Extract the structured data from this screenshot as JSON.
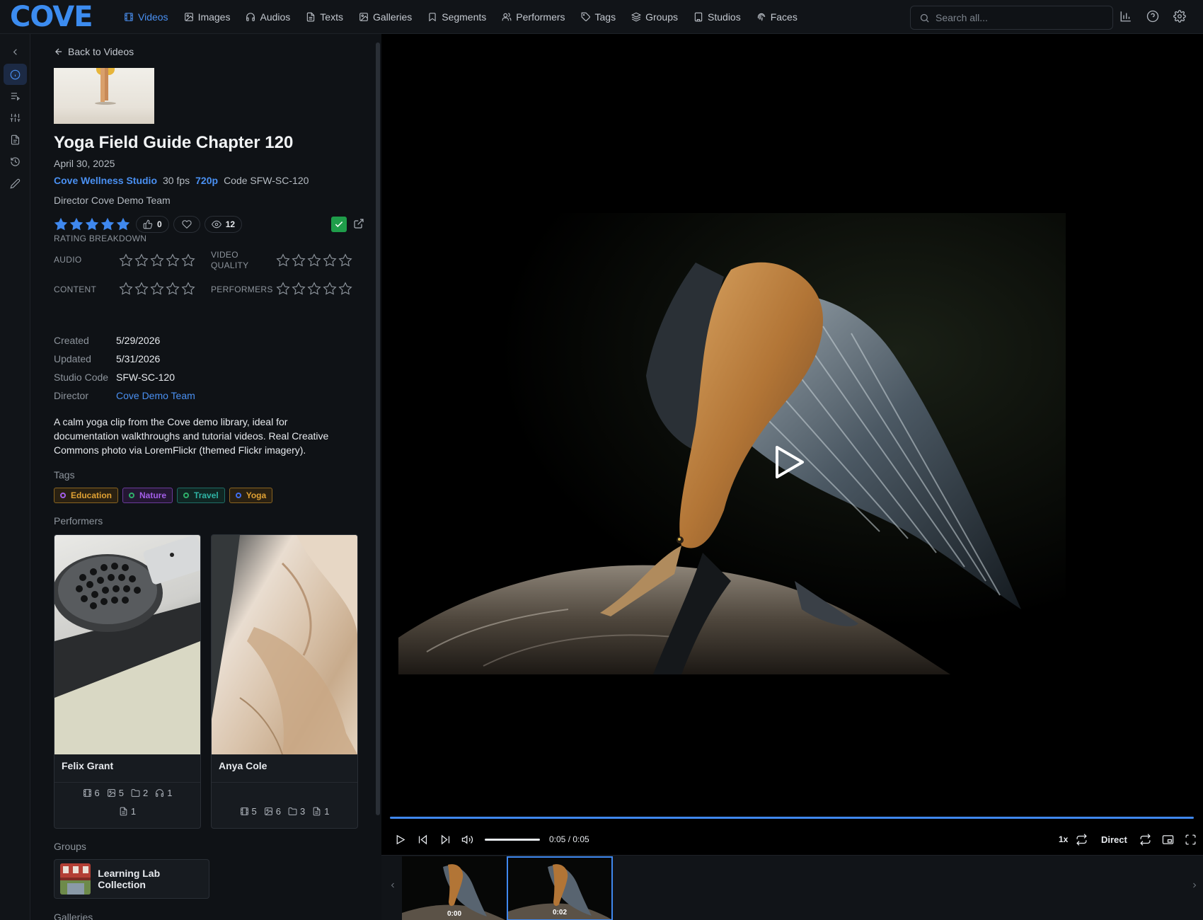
{
  "app": {
    "logo_text": "COVE"
  },
  "nav": {
    "items": [
      {
        "label": "Videos",
        "icon": "film-icon",
        "active": true
      },
      {
        "label": "Images",
        "icon": "image-icon"
      },
      {
        "label": "Audios",
        "icon": "headphones-icon"
      },
      {
        "label": "Texts",
        "icon": "file-text-icon"
      },
      {
        "label": "Galleries",
        "icon": "gallery-icon"
      },
      {
        "label": "Segments",
        "icon": "bookmark-icon"
      },
      {
        "label": "Performers",
        "icon": "users-icon"
      },
      {
        "label": "Tags",
        "icon": "tag-icon"
      },
      {
        "label": "Groups",
        "icon": "layers-icon"
      },
      {
        "label": "Studios",
        "icon": "building-icon"
      },
      {
        "label": "Faces",
        "icon": "fingerprint-icon"
      }
    ],
    "search_placeholder": "Search all...",
    "right_icons": [
      "stats-icon",
      "help-icon",
      "settings-icon"
    ]
  },
  "rail": {
    "items": [
      {
        "icon": "collapse-chevron-icon"
      },
      {
        "icon": "info-icon",
        "active": true
      },
      {
        "icon": "queue-icon"
      },
      {
        "icon": "sliders-icon"
      },
      {
        "icon": "file-icon"
      },
      {
        "icon": "history-icon"
      },
      {
        "icon": "edit-icon"
      }
    ]
  },
  "detail": {
    "back_label": "Back to Videos",
    "title": "Yoga Field Guide Chapter 120",
    "date": "April 30, 2025",
    "studio": "Cove Wellness Studio",
    "fps": "30 fps",
    "resolution": "720p",
    "code_line": "Code SFW-SC-120",
    "director_line": "Director Cove Demo Team",
    "rating": 5,
    "likes": "0",
    "views": "12",
    "rating_breakdown_label": "RATING BREAKDOWN",
    "breakdown": [
      {
        "label": "AUDIO",
        "value": 0
      },
      {
        "label": "VIDEO QUALITY",
        "value": 0
      },
      {
        "label": "CONTENT",
        "value": 0
      },
      {
        "label": "PERFORMERS",
        "value": 0
      }
    ],
    "fields": [
      {
        "key": "Created",
        "value": "5/29/2026"
      },
      {
        "key": "Updated",
        "value": "5/31/2026"
      },
      {
        "key": "Studio Code",
        "value": "SFW-SC-120"
      },
      {
        "key": "Director",
        "value": "Cove Demo Team",
        "link": true
      }
    ],
    "description": "A calm yoga clip from the Cove demo library, ideal for documentation walkthroughs and tutorial videos. Real Creative Commons photo via LoremFlickr (themed Flickr imagery).",
    "tags_heading": "Tags",
    "tags": [
      {
        "label": "Education",
        "color": "#e0a133"
      },
      {
        "label": "Nature",
        "color": "#a35ee8"
      },
      {
        "label": "Travel",
        "color": "#2fb4a5"
      },
      {
        "label": "Yoga",
        "color": "#e0a133"
      }
    ],
    "performers_heading": "Performers",
    "performers": [
      {
        "name": "Felix Grant",
        "stats_row1": [
          "6",
          "5",
          "2",
          "1"
        ],
        "stats_row2": [
          "1"
        ]
      },
      {
        "name": "Anya Cole",
        "stats_row1": [
          "5",
          "6",
          "3",
          "1"
        ]
      }
    ],
    "groups_heading": "Groups",
    "groups": [
      {
        "name": "Learning Lab Collection"
      }
    ],
    "galleries_heading": "Galleries"
  },
  "player": {
    "time": "0:05 / 0:05",
    "speed": "1x",
    "mode": "Direct",
    "progress": 1.0,
    "volume": 1.0
  },
  "filmstrip": {
    "frames": [
      {
        "timestamp": "0:00",
        "selected": false
      },
      {
        "timestamp": "0:02",
        "selected": true
      }
    ]
  },
  "colors": {
    "accent": "#3f88ef",
    "check": "#1f9d4a"
  }
}
